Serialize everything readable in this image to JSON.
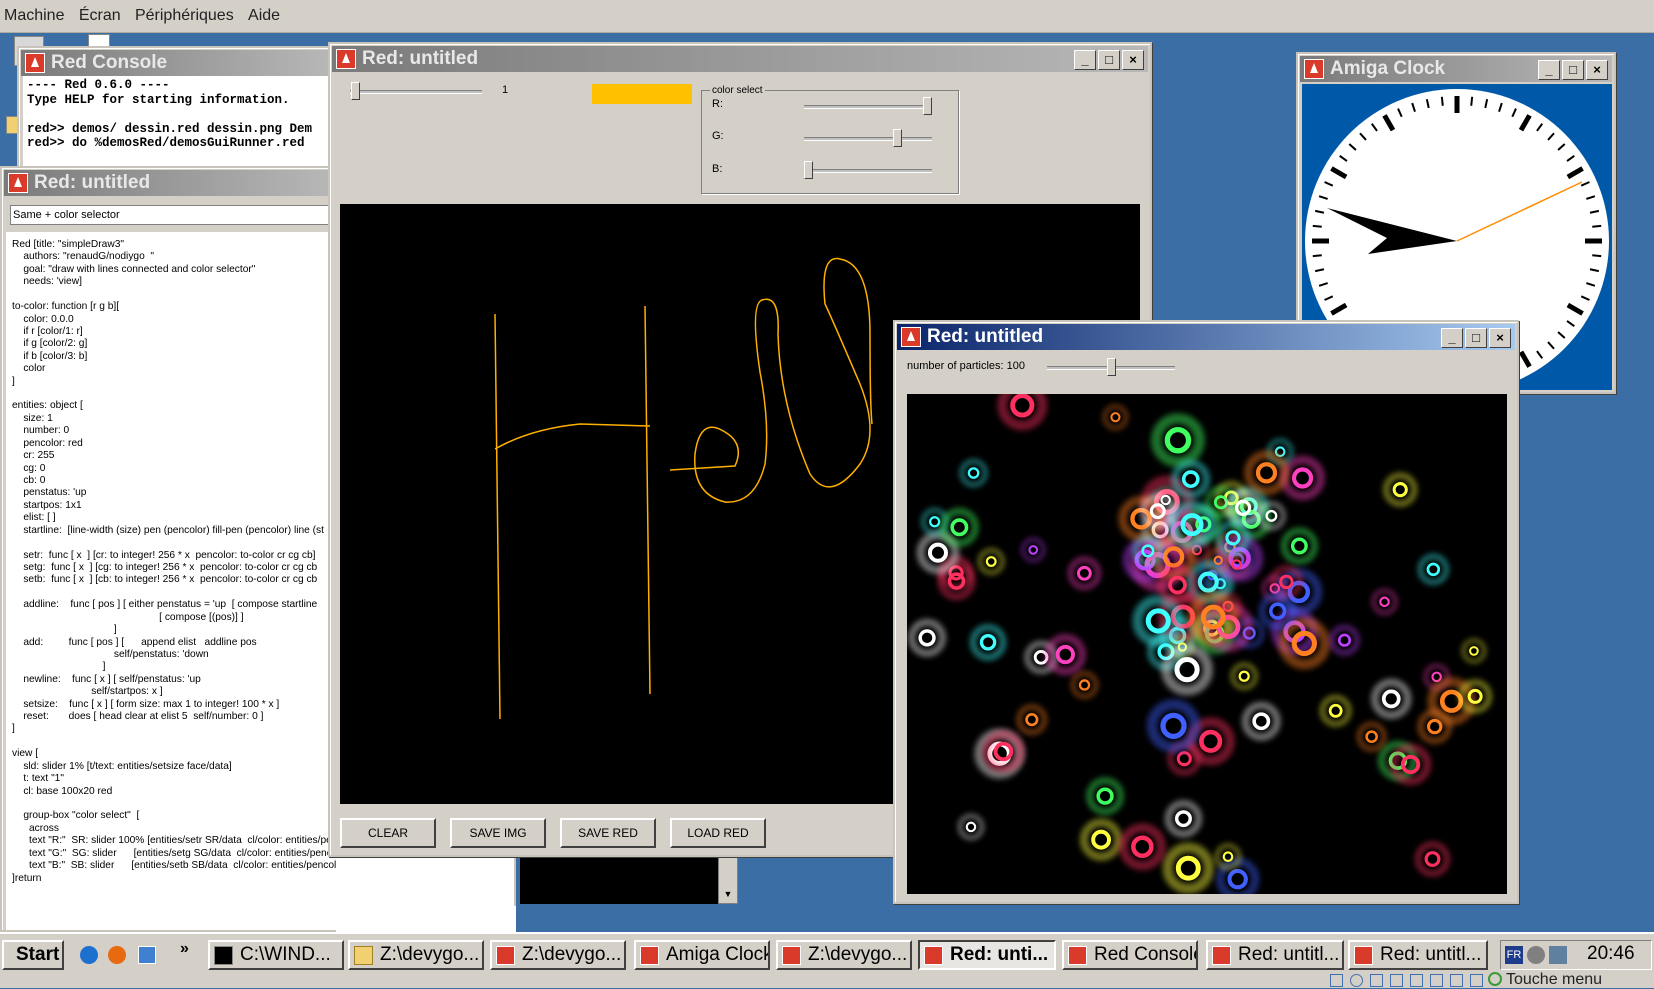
{
  "vbox_menu": [
    "Machine",
    "Écran",
    "Périphériques",
    "Aide"
  ],
  "console": {
    "title": "Red Console",
    "lines": [
      "---- Red 0.6.0 ----",
      "Type HELP for starting information.",
      "",
      "red>> demos/ dessin.red dessin.png Dem",
      "red>> do %demosRed/demosGuiRunner.red"
    ]
  },
  "runner": {
    "title": "Red: untitled",
    "field": "Same + color selector",
    "code": "Red [title: \"simpleDraw3\"\n    authors: \"renaudG/nodiygo  \"\n    goal: \"draw with lines connected and color selector\"\n    needs: 'view]\n\nto-color: function [r g b][\n    color: 0.0.0\n    if r [color/1: r]\n    if g [color/2: g]\n    if b [color/3: b]\n    color\n]\n\nentities: object [\n    size: 1\n    number: 0\n    pencolor: red\n    cr: 255\n    cg: 0\n    cb: 0\n    penstatus: 'up\n    startpos: 1x1\n    elist: [ ]\n    startline:  [line-width (size) pen (pencolor) fill-pen (pencolor) line (st\n\n    setr:  func [ x  ] [cr: to integer! 256 * x  pencolor: to-color cr cg cb]\n    setg:  func [ x  ] [cg: to integer! 256 * x  pencolor: to-color cr cg cb\n    setb:  func [ x  ] [cb: to integer! 256 * x  pencolor: to-color cr cg cb\n\n    addline:    func [ pos ] [ either penstatus = 'up  [ compose startline\n                                                    [ compose [(pos)] ]\n                                    ]\n    add:         func [ pos ] [      append elist   addline pos\n                                    self/penstatus: 'down\n                                ]\n    newline:    func [ x ] [ self/penstatus: 'up\n                            self/startpos: x ]\n    setsize:    func [ x ] [ form size: max 1 to integer! 100 * x ]\n    reset:       does [ head clear at elist 5  self/number: 0 ]\n]\n\nview [\n    sld: slider 1% [t/text: entities/setsize face/data]\n    t: text \"1\"\n    cl: base 100x20 red\n\n    group-box \"color select\"  [\n      across\n      text \"R:\"  SR: slider 100% [entities/setr SR/data  cl/color: entities/pencolor] return\n      text \"G:\"  SG: slider      [entities/setg SG/data  cl/color: entities/pencolor] return\n      text \"B:\"  SB: slider      [entities/setb SB/data  cl/color: entities/pencolor]\n]return"
  },
  "draw": {
    "title": "Red: untitled",
    "size_value": "1",
    "size_slider": 0.01,
    "swatch_color": "#ffc000",
    "group_title": "color select",
    "r_label": "R:",
    "g_label": "G:",
    "b_label": "B:",
    "r_value": 1.0,
    "g_value": 0.75,
    "b_value": 0.0,
    "buttons": [
      "CLEAR",
      "SAVE IMG",
      "SAVE RED",
      "LOAD RED"
    ],
    "ink_color": "#ffb000"
  },
  "clock": {
    "title": "Amiga Clock"
  },
  "particles": {
    "title": "Red: untitled",
    "count_label": "number of particles: 100",
    "count_slider": 0.5
  },
  "taskbar": {
    "start": "Start",
    "tasks": [
      "C:\\WIND...",
      "Z:\\devygo...",
      "Z:\\devygo...",
      "Amiga Clock",
      "Z:\\devygo...",
      "Red: unti...",
      "Red Console",
      "Red: untitl...",
      "Red: untitl..."
    ],
    "lang": "FR",
    "time": "20:46",
    "host_key": "Touche menu"
  }
}
